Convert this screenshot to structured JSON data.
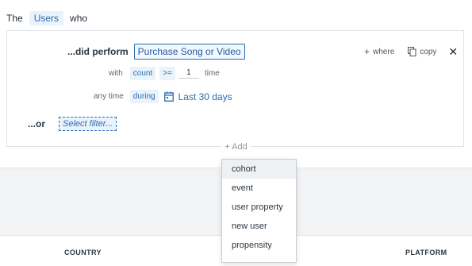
{
  "header": {
    "prefix": "The",
    "entity": "Users",
    "suffix": "who"
  },
  "condition": {
    "did_perform_label": "...did perform",
    "event_name": "Purchase Song or Video",
    "with_label": "with",
    "metric": "count",
    "operator": ">=",
    "value": "1",
    "unit": "time",
    "time_label": "any time",
    "time_mode": "during",
    "date_range": "Last 30 days",
    "or_label": "...or",
    "filter_placeholder": "Select filter..."
  },
  "actions": {
    "where": "where",
    "copy": "copy"
  },
  "add_button": "+ Add",
  "dropdown": {
    "items": [
      "cohort",
      "event",
      "user property",
      "new user",
      "propensity"
    ],
    "highlighted": "cohort"
  },
  "table_headers": {
    "country": "COUNTRY",
    "platform": "PLATFORM"
  },
  "colors": {
    "accent": "#2b6cb0",
    "chip_bg": "#eaf2fb",
    "band_bg": "#f2f3f5"
  }
}
